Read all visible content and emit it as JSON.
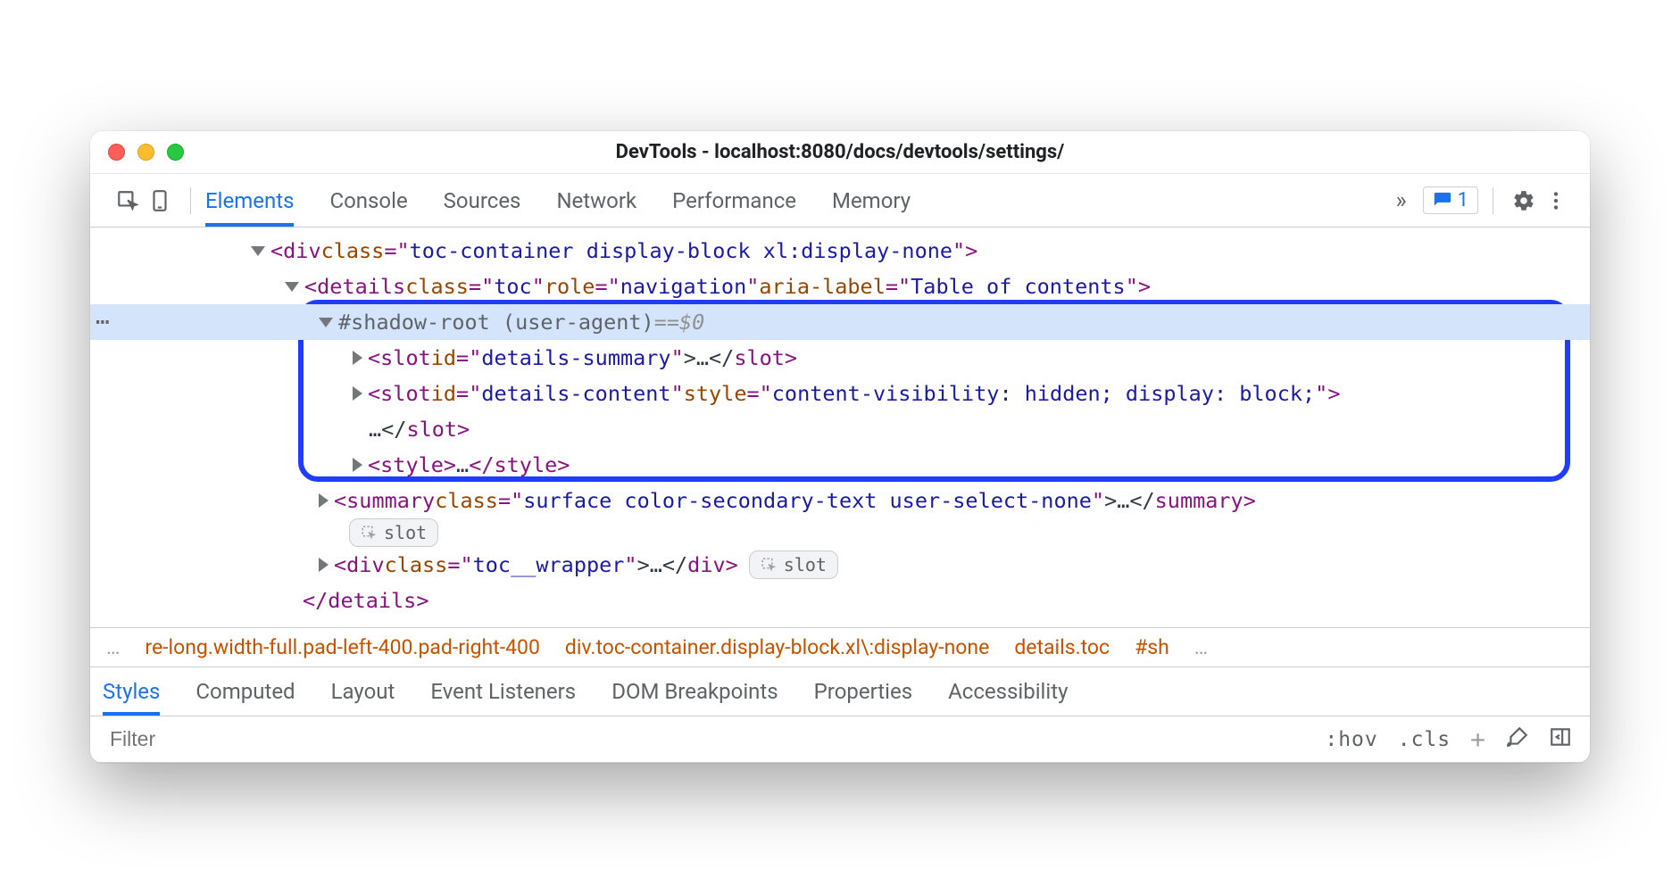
{
  "window": {
    "title": "DevTools - localhost:8080/docs/devtools/settings/"
  },
  "toolbar": {
    "tabs": [
      "Elements",
      "Console",
      "Sources",
      "Network",
      "Performance",
      "Memory"
    ],
    "active_tab": 0,
    "issue_count": "1"
  },
  "dom": {
    "line1": {
      "tag_open": "<div ",
      "attr1": "class",
      "val1": "toc-container display-block xl:display-none",
      "tag_close": ">"
    },
    "line2": {
      "tag_open": "<details ",
      "a1": "class",
      "v1": "toc",
      "a2": "role",
      "v2": "navigation",
      "a3": "aria-label",
      "v3": "Table of contents",
      "tag_close": ">"
    },
    "line3": {
      "shadow_label": "#shadow-root (user-agent)",
      "eq": " == ",
      "sel": "$0"
    },
    "line4": {
      "tag_open": "<slot ",
      "a1": "id",
      "v1": "details-summary",
      "mid": ">…</",
      "tag_name": "slot",
      "end": ">"
    },
    "line5": {
      "tag_open": "<slot ",
      "a1": "id",
      "v1": "details-content",
      "a2": "style",
      "v2": "content-visibility: hidden; display: block;",
      "tag_close": ">"
    },
    "line5b": {
      "text": "…</",
      "tag": "slot",
      "end": ">"
    },
    "line6": {
      "open": "<style>",
      "mid": "…",
      "close": "</style>"
    },
    "line7": {
      "tag_open": "<summary ",
      "a1": "class",
      "v1": "surface color-secondary-text user-select-none",
      "mid": ">…</",
      "tag": "summary",
      "end": ">"
    },
    "badge_slot": "slot",
    "line8": {
      "tag_open": "<div ",
      "a1": "class",
      "v1": "toc__wrapper",
      "mid": ">…</",
      "tag": "div",
      "end": ">"
    },
    "line9": {
      "close": "</details>"
    }
  },
  "breadcrumbs": {
    "p1": "re-long.width-full.pad-left-400.pad-right-400",
    "p2": "div.toc-container.display-block.xl\\:display-none",
    "p3": "details.toc",
    "p4": "#sh"
  },
  "styles_tabs": [
    "Styles",
    "Computed",
    "Layout",
    "Event Listeners",
    "DOM Breakpoints",
    "Properties",
    "Accessibility"
  ],
  "filter": {
    "placeholder": "Filter",
    "hov": ":hov",
    "cls": ".cls"
  }
}
